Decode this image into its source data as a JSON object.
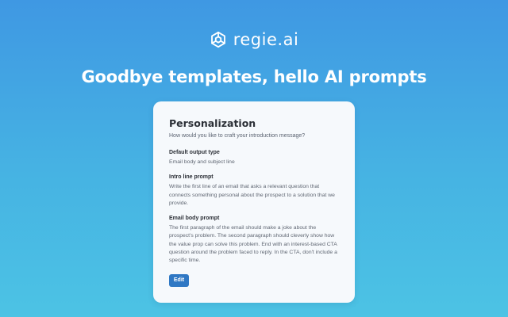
{
  "brand": {
    "name": "regie.ai",
    "logo_icon": "hexagon-swirl-icon"
  },
  "headline": "Goodbye templates, hello AI prompts",
  "card": {
    "title": "Personalization",
    "subtitle": "How would you like to craft your introduction message?",
    "sections": [
      {
        "label": "Default output type",
        "text": "Email body and subject line"
      },
      {
        "label": "Intro line prompt",
        "text": "Write the first line of an email that asks a relevant question that connects something personal about the prospect to a solution that we provide."
      },
      {
        "label": "Email body prompt",
        "text": "The first paragraph of the email should make a joke about the prospect's problem. The second paragraph should cleverly show how the value prop can solve this problem. End with an interest-based CTA question around the problem faced to reply. In the CTA, don't include a specific time."
      }
    ],
    "edit_label": "Edit"
  },
  "colors": {
    "background_top": "#3f98e3",
    "background_bottom": "#4cc3e4",
    "card_background": "#f6f9fc",
    "button": "#2f78c4"
  }
}
